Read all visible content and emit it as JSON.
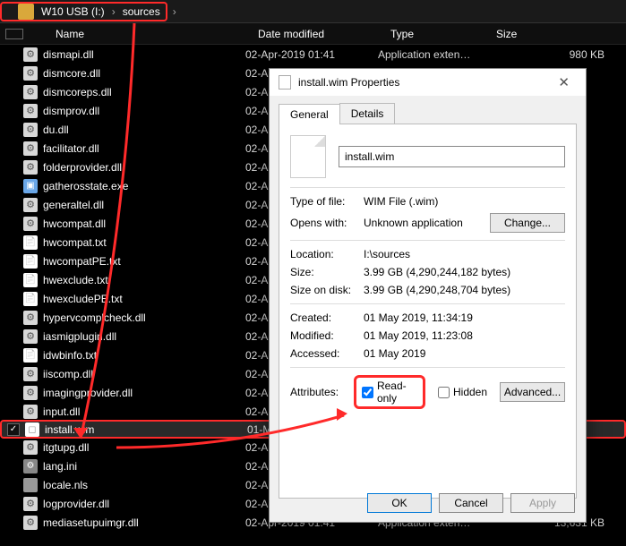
{
  "breadcrumb": {
    "drive": "W10 USB (I:)",
    "folder": "sources"
  },
  "columns": {
    "name": "Name",
    "date": "Date modified",
    "type": "Type",
    "size": "Size"
  },
  "files": [
    {
      "name": "dismapi.dll",
      "icon": "dll",
      "date": "02-Apr-2019 01:41",
      "type": "Application exten…",
      "size": "980 KB"
    },
    {
      "name": "dismcore.dll",
      "icon": "dll",
      "date": "02-A",
      "type": "",
      "size": ""
    },
    {
      "name": "dismcoreps.dll",
      "icon": "dll",
      "date": "02-A",
      "type": "",
      "size": ""
    },
    {
      "name": "dismprov.dll",
      "icon": "dll",
      "date": "02-A",
      "type": "",
      "size": ""
    },
    {
      "name": "du.dll",
      "icon": "dll",
      "date": "02-A",
      "type": "",
      "size": ""
    },
    {
      "name": "facilitator.dll",
      "icon": "dll",
      "date": "02-A",
      "type": "",
      "size": ""
    },
    {
      "name": "folderprovider.dll",
      "icon": "dll",
      "date": "02-A",
      "type": "",
      "size": ""
    },
    {
      "name": "gatherosstate.exe",
      "icon": "exe",
      "date": "02-A",
      "type": "",
      "size": ""
    },
    {
      "name": "generaltel.dll",
      "icon": "dll",
      "date": "02-A",
      "type": "",
      "size": ""
    },
    {
      "name": "hwcompat.dll",
      "icon": "dll",
      "date": "02-A",
      "type": "",
      "size": ""
    },
    {
      "name": "hwcompat.txt",
      "icon": "txt",
      "date": "02-A",
      "type": "",
      "size": ""
    },
    {
      "name": "hwcompatPE.txt",
      "icon": "txt",
      "date": "02-A",
      "type": "",
      "size": ""
    },
    {
      "name": "hwexclude.txt",
      "icon": "txt",
      "date": "02-A",
      "type": "",
      "size": ""
    },
    {
      "name": "hwexcludePE.txt",
      "icon": "txt",
      "date": "02-A",
      "type": "",
      "size": ""
    },
    {
      "name": "hypervcomplcheck.dll",
      "icon": "dll",
      "date": "02-A",
      "type": "",
      "size": ""
    },
    {
      "name": "iasmigplugin.dll",
      "icon": "dll",
      "date": "02-A",
      "type": "",
      "size": ""
    },
    {
      "name": "idwbinfo.txt",
      "icon": "txt",
      "date": "02-A",
      "type": "",
      "size": ""
    },
    {
      "name": "iiscomp.dll",
      "icon": "dll",
      "date": "02-A",
      "type": "",
      "size": ""
    },
    {
      "name": "imagingprovider.dll",
      "icon": "dll",
      "date": "02-A",
      "type": "",
      "size": ""
    },
    {
      "name": "input.dll",
      "icon": "dll",
      "date": "02-A",
      "type": "",
      "size": ""
    },
    {
      "name": "install.wim",
      "icon": "wim",
      "date": "01-M",
      "type": "",
      "size": "",
      "selected": true,
      "highlight": true
    },
    {
      "name": "itgtupg.dll",
      "icon": "dll",
      "date": "02-A",
      "type": "",
      "size": ""
    },
    {
      "name": "lang.ini",
      "icon": "ini",
      "date": "02-A",
      "type": "",
      "size": ""
    },
    {
      "name": "locale.nls",
      "icon": "nls",
      "date": "02-A",
      "type": "",
      "size": ""
    },
    {
      "name": "logprovider.dll",
      "icon": "dll",
      "date": "02-A",
      "type": "",
      "size": ""
    },
    {
      "name": "mediasetupuimgr.dll",
      "icon": "dll",
      "date": "02-Apr-2019 01:41",
      "type": "Application exten…",
      "size": "13,631 KB"
    }
  ],
  "dialog": {
    "title": "install.wim Properties",
    "tabs": {
      "general": "General",
      "details": "Details"
    },
    "filename": "install.wim",
    "labels": {
      "type_of_file": "Type of file:",
      "opens_with": "Opens with:",
      "location": "Location:",
      "size": "Size:",
      "size_on_disk": "Size on disk:",
      "created": "Created:",
      "modified": "Modified:",
      "accessed": "Accessed:",
      "attributes": "Attributes:",
      "read_only": "Read-only",
      "hidden": "Hidden"
    },
    "values": {
      "type_of_file": "WIM File (.wim)",
      "opens_with": "Unknown application",
      "location": "I:\\sources",
      "size": "3.99 GB (4,290,244,182 bytes)",
      "size_on_disk": "3.99 GB (4,290,248,704 bytes)",
      "created": "01 May 2019, 11:34:19",
      "modified": "01 May 2019, 11:23:08",
      "accessed": "01 May 2019"
    },
    "read_only_checked": true,
    "hidden_checked": false,
    "buttons": {
      "change": "Change...",
      "advanced": "Advanced...",
      "ok": "OK",
      "cancel": "Cancel",
      "apply": "Apply"
    }
  }
}
